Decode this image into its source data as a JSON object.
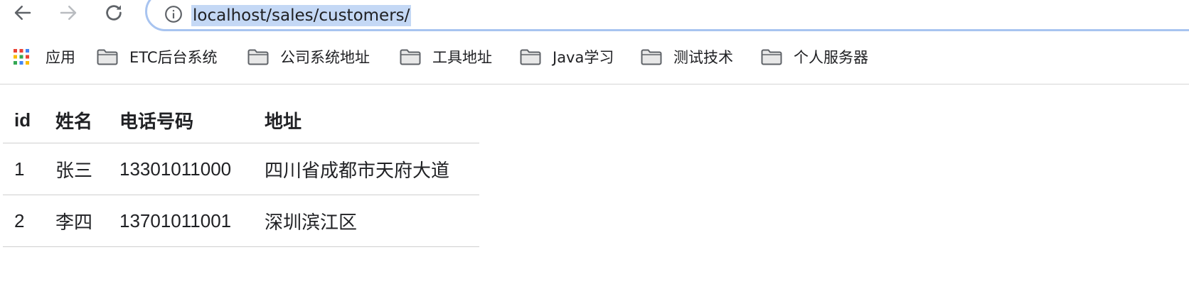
{
  "browser": {
    "address_bar": {
      "url": "localhost/sales/customers/"
    }
  },
  "bookmarks": [
    {
      "label": "应用",
      "icon": "apps-grid-icon"
    },
    {
      "label": "ETC后台系统",
      "icon": "folder-icon"
    },
    {
      "label": "公司系统地址",
      "icon": "folder-icon"
    },
    {
      "label": "工具地址",
      "icon": "folder-icon"
    },
    {
      "label": "Java学习",
      "icon": "folder-icon"
    },
    {
      "label": "测试技术",
      "icon": "folder-icon"
    },
    {
      "label": "个人服务器",
      "icon": "folder-icon"
    }
  ],
  "table": {
    "headers": [
      "id",
      "姓名",
      "电话号码",
      "地址"
    ],
    "rows": [
      [
        "1",
        "张三",
        "13301011000",
        "四川省成都市天府大道"
      ],
      [
        "2",
        "李四",
        "13701011001",
        "深圳滨江区"
      ]
    ]
  },
  "colors": {
    "selection": "#c4d8f5",
    "omnibox_border": "#a8c4f0",
    "folder": "#5f6368"
  }
}
